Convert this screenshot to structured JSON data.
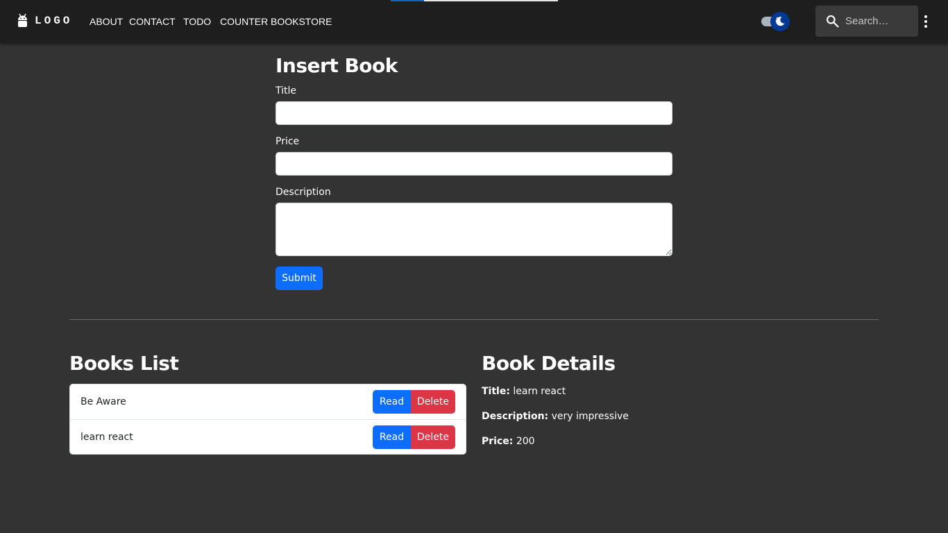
{
  "navbar": {
    "logo_text": "LOGO",
    "links": [
      "ABOUT",
      "CONTACT",
      "TODO",
      "COUNTER",
      "BOOKSTORE"
    ],
    "search_placeholder": "Search…"
  },
  "progress": {
    "fraction": 0.2
  },
  "form": {
    "title": "Insert Book",
    "title_label": "Title",
    "price_label": "Price",
    "description_label": "Description",
    "submit_label": "Submit"
  },
  "books_list": {
    "heading": "Books List",
    "items": [
      {
        "title": "Be Aware",
        "read_label": "Read",
        "delete_label": "Delete"
      },
      {
        "title": "learn react",
        "read_label": "Read",
        "delete_label": "Delete"
      }
    ]
  },
  "book_details": {
    "heading": "Book Details",
    "title_key": "Title:",
    "title_value": "learn react",
    "description_key": "Description:",
    "description_value": "very impressive",
    "price_key": "Price:",
    "price_value": "200"
  },
  "colors": {
    "page_background": "#333333",
    "navbar_background": "#1e1e1e",
    "primary": "#0d6efd",
    "danger": "#dc3545",
    "toggle_thumb": "#003892"
  },
  "icons": {
    "brand": "android-icon",
    "theme": "moon-icon",
    "search": "search-icon",
    "more": "more-vert-icon"
  }
}
